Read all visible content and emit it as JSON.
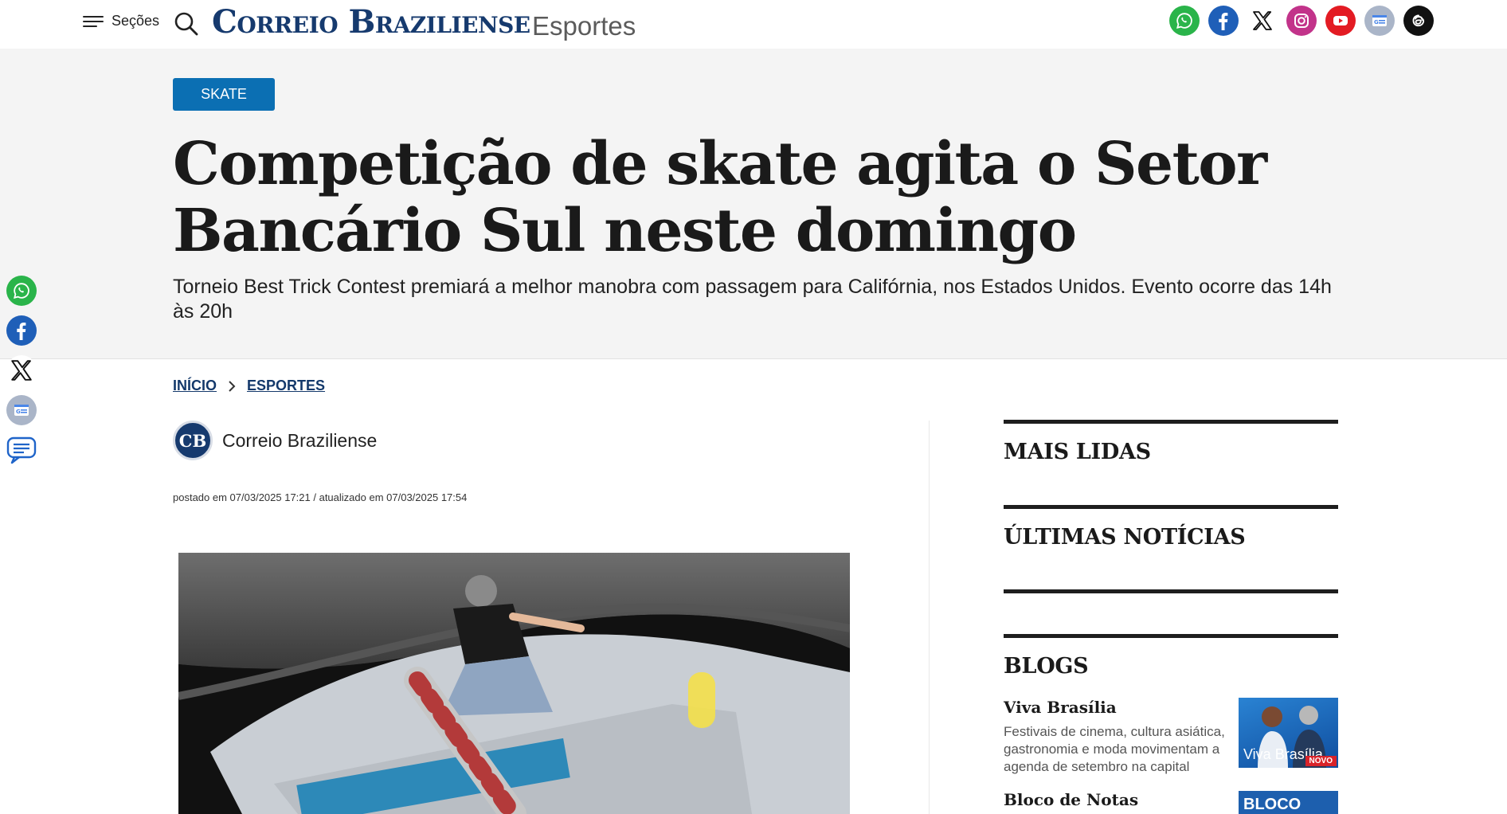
{
  "header": {
    "menu_label": "Seções",
    "logo_text": "Correio Braziliense",
    "section_name": "Esportes",
    "social_icons": [
      "whatsapp-icon",
      "facebook-icon",
      "x-icon",
      "instagram-icon",
      "youtube-icon",
      "google-news-icon",
      "threads-icon"
    ]
  },
  "article": {
    "tag": "SKATE",
    "headline": "Competição de skate agita o Setor Bancário Sul neste domingo",
    "subhead": "Torneio Best Trick Contest premiará a melhor manobra com passagem para Califórnia, nos Estados Unidos. Evento ocorre das 14h às 20h",
    "author_initials": "CB",
    "author_name": "Correio Braziliense",
    "dateline": "postado em 07/03/2025 17:21 / atualizado em 07/03/2025 17:54"
  },
  "breadcrumb": [
    "INÍCIO",
    "ESPORTES"
  ],
  "share_rail": [
    "whatsapp-icon",
    "facebook-icon",
    "x-icon",
    "google-news-icon",
    "comments-icon"
  ],
  "sidebar": {
    "most_read_title": "MAIS LIDAS",
    "latest_title": "ÚLTIMAS NOTÍCIAS",
    "blogs_title": "BLOGS",
    "blogs": [
      {
        "name": "Viva Brasília",
        "desc": "Festivais de cinema, cultura asiática, gastronomia e moda movimentam a agenda de setembro na capital",
        "thumb_text": "Viva Brasília",
        "badge": "NOVO"
      },
      {
        "name": "Bloco de Notas",
        "thumb_text": "BLOCO"
      }
    ]
  },
  "colors": {
    "brand_navy": "#163a6e",
    "tag_blue": "#0b6fb3",
    "hero_bg": "#f4f4f4"
  }
}
